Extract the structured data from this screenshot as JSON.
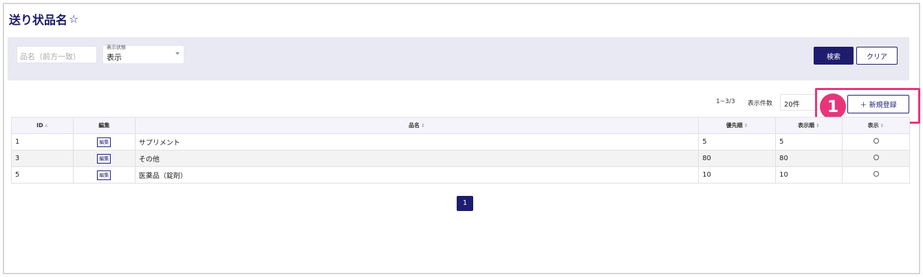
{
  "page": {
    "title": "送り状品名",
    "star": "☆"
  },
  "search": {
    "name_placeholder": "品名（前方一致）",
    "status_label": "表示状態",
    "status_value": "表示",
    "search_label": "検索",
    "clear_label": "クリア"
  },
  "list_controls": {
    "range": "1~3/3",
    "per_page_label": "表示件数",
    "per_page_value": "20件",
    "add_label": "＋ 新規登録"
  },
  "callout": {
    "number": "1"
  },
  "table": {
    "headers": {
      "id": "ID",
      "edit": "編集",
      "name": "品名",
      "priority": "優先順",
      "order": "表示順",
      "display": "表示"
    },
    "edit_link": "編集",
    "rows": [
      {
        "id": "1",
        "name": "サプリメント",
        "priority": "5",
        "order": "5"
      },
      {
        "id": "3",
        "name": "その他",
        "priority": "80",
        "order": "80"
      },
      {
        "id": "5",
        "name": "医薬品（錠剤）",
        "priority": "10",
        "order": "10"
      }
    ]
  },
  "pagination": {
    "current": "1"
  },
  "colors": {
    "brand": "#1e1c6d",
    "highlight": "#e8347a",
    "panel": "#e8e9f2"
  }
}
